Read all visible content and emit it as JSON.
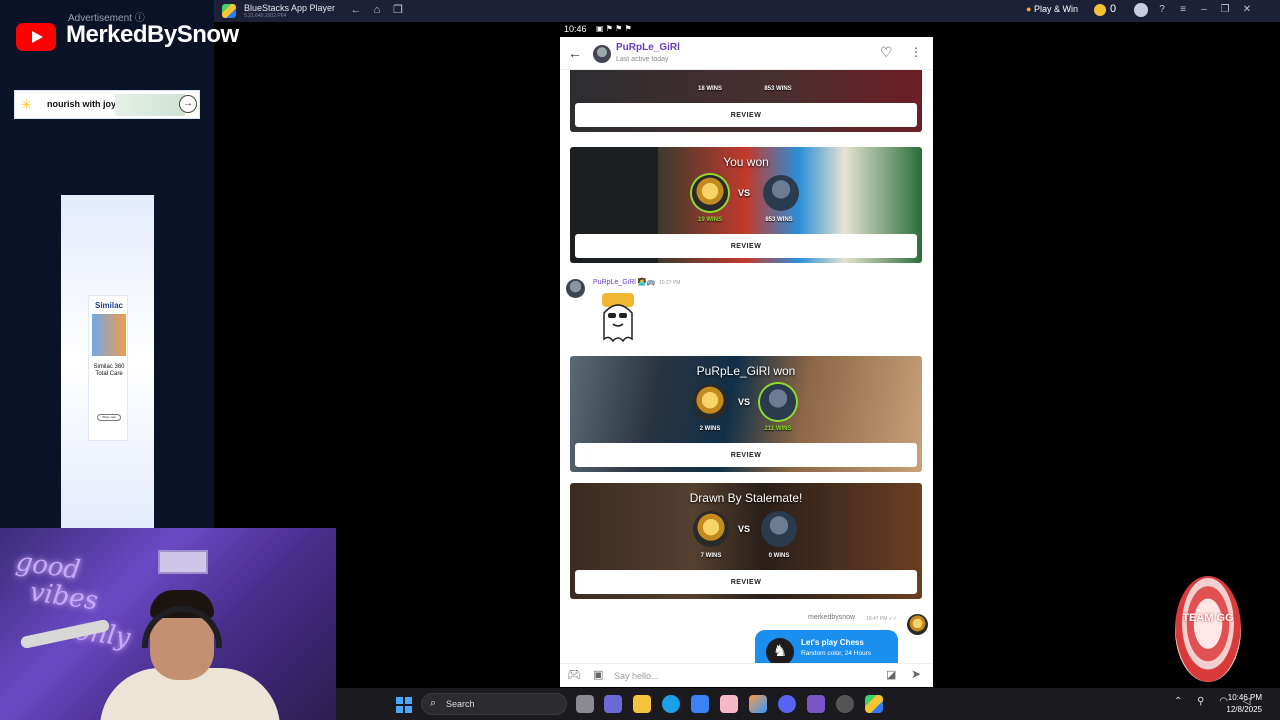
{
  "bluestacks": {
    "title": "BlueStacks App Player",
    "subtitle": "5.21.640.1002 P64",
    "play_win": "Play & Win",
    "coins": "0"
  },
  "stream": {
    "ad_label": "Advertisement ⓘ",
    "channel": "MerkedBySnow",
    "banner_text": "nourish with joy",
    "similac_brand": "Similac",
    "similac_name": "Similac 360 Total Care",
    "similac_shop": "Shop now",
    "neon_good": "good",
    "neon_vibes": "vibes",
    "neon_only": "only",
    "badge_text": "TEAM GG"
  },
  "status_bar": {
    "time": "10:46",
    "icons": "▣ ⚑ ⚑ ⚑"
  },
  "chat": {
    "peer_name": "PuRpLe_GiRl",
    "peer_status": "Last active today",
    "cards": [
      {
        "title": "",
        "left_wins": "18 WINS",
        "right_wins": "853 WINS",
        "review": "REVIEW"
      },
      {
        "title": "You won",
        "left_wins": "19 WINS",
        "right_wins": "853 WINS",
        "review": "REVIEW"
      },
      {
        "title": "PuRpLe_GiRl won",
        "left_wins": "2 WINS",
        "right_wins": "211 WINS",
        "review": "REVIEW"
      },
      {
        "title": "Drawn By Stalemate!",
        "left_wins": "7 WINS",
        "right_wins": "0 WINS",
        "review": "REVIEW"
      }
    ],
    "vs_label": "VS",
    "peer_msg": {
      "name": "PuRpLe_GiRl 👩‍💻🚌",
      "time": "10:27 PM"
    },
    "my_msg": {
      "name": "merkedbysnow",
      "time": "10:47 PM ✓✓"
    },
    "invite": {
      "title": "Let's play Chess",
      "subtitle": "Random color, 24 Hours",
      "icon": "♞"
    },
    "composer_placeholder": "Say hello..."
  },
  "taskbar": {
    "search_label": "Search",
    "clock_time": "10:46 PM",
    "clock_date": "12/8/2025",
    "tray": "⌃ ⚲ ◠ ◁"
  },
  "colors": {
    "accent": "#1b8ff0",
    "peer_name": "#6a3bc6",
    "win_green": "#8edc2d"
  },
  "icons": {
    "back": "arrow-left-icon",
    "heart": "heart-icon",
    "more": "kebab-icon",
    "send": "send-icon",
    "attach": "attach-icon",
    "game": "gamepad-icon"
  }
}
